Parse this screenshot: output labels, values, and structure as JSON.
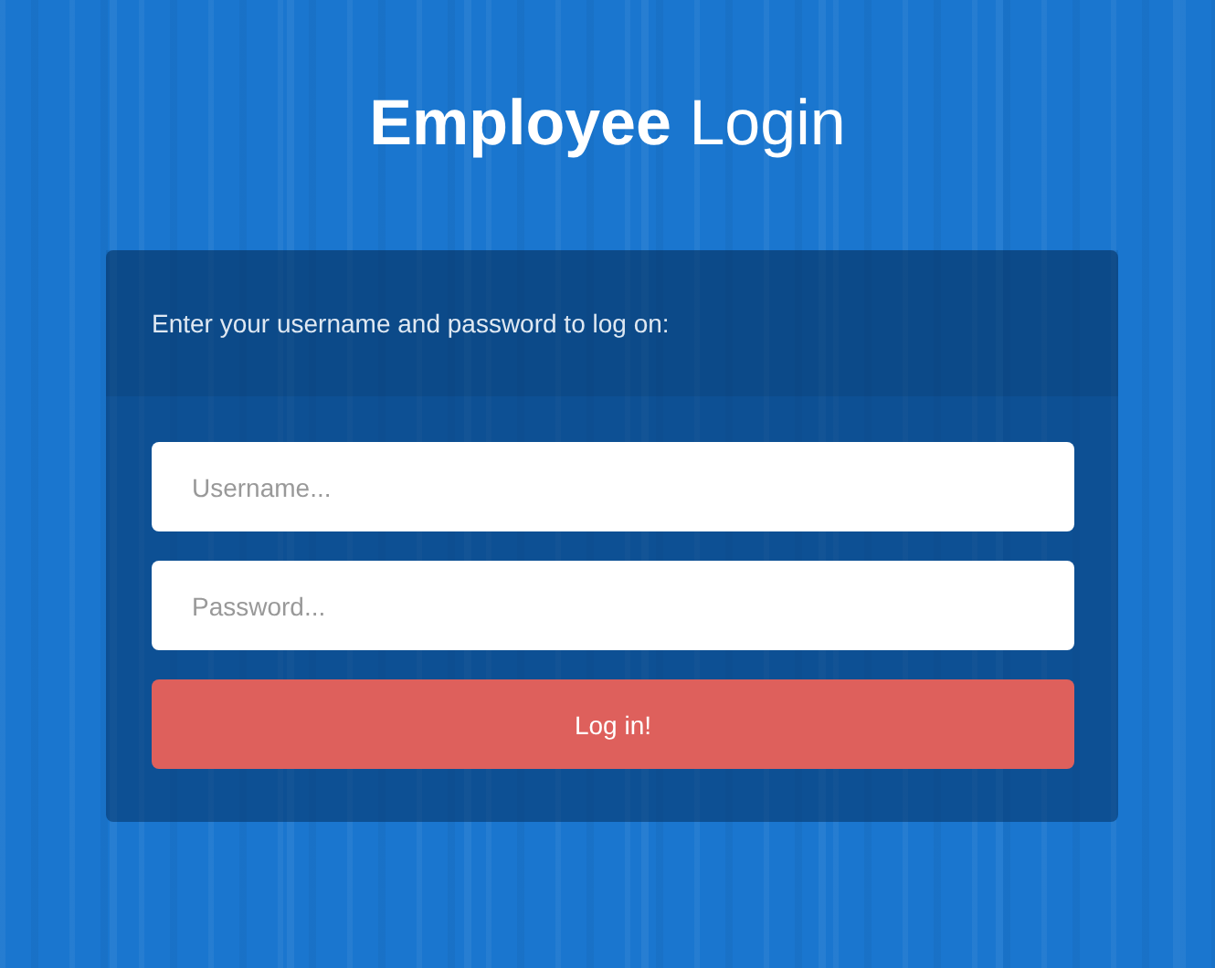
{
  "title": "**Employee** Login",
  "panel": {
    "instructions": "Enter your username and password to log on:"
  },
  "fields": [
    {
      "placeholder": "Username..."
    },
    {
      "placeholder": "Password..."
    }
  ],
  "button": "Log in!"
}
